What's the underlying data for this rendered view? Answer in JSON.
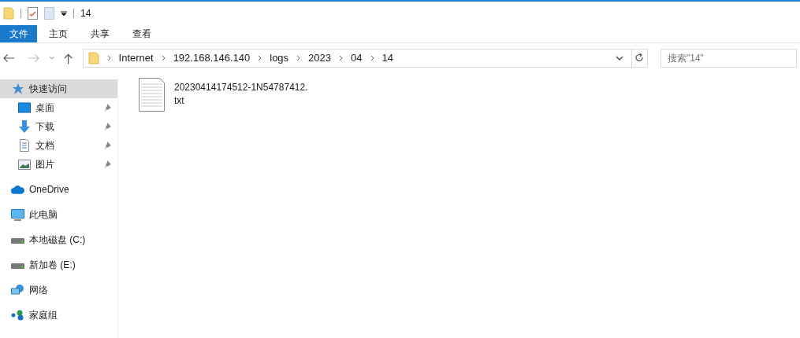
{
  "window": {
    "title": "14"
  },
  "ribbon_tabs": [
    {
      "label": "文件",
      "selected": true
    },
    {
      "label": "主页",
      "selected": false
    },
    {
      "label": "共享",
      "selected": false
    },
    {
      "label": "查看",
      "selected": false
    }
  ],
  "address": {
    "path": [
      "Internet",
      "192.168.146.140",
      "logs",
      "2023",
      "04",
      "14"
    ]
  },
  "search": {
    "placeholder": "搜索\"14\""
  },
  "sidebar": {
    "items": [
      {
        "label": "快速访问",
        "kind": "star",
        "selected": true,
        "children": [
          {
            "label": "桌面",
            "kind": "desktop",
            "selected": false,
            "pinned": true
          },
          {
            "label": "下载",
            "kind": "download",
            "selected": false,
            "pinned": true
          },
          {
            "label": "文档",
            "kind": "document",
            "selected": false,
            "pinned": true
          },
          {
            "label": "图片",
            "kind": "pictures",
            "selected": false,
            "pinned": true
          }
        ]
      },
      {
        "label": "OneDrive",
        "kind": "cloud",
        "selected": false
      },
      {
        "label": "此电脑",
        "kind": "computer",
        "selected": false
      },
      {
        "label": "本地磁盘 (C:)",
        "kind": "drive",
        "selected": false
      },
      {
        "label": "新加卷 (E:)",
        "kind": "drive",
        "selected": false
      },
      {
        "label": "网络",
        "kind": "network",
        "selected": false
      },
      {
        "label": "家庭组",
        "kind": "homegroup",
        "selected": false
      }
    ]
  },
  "files": [
    {
      "name": "20230414174512-1N54787412.txt",
      "kind": "text"
    }
  ]
}
